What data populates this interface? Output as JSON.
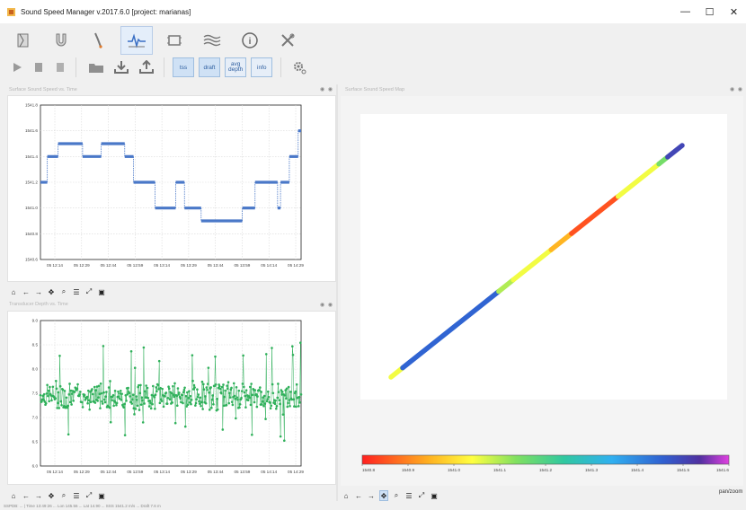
{
  "window": {
    "title": "Sound Speed Manager v.2017.6.0 [project: marianas]",
    "minimize": "—",
    "maximize": "☐",
    "close": "✕"
  },
  "tabs": [
    {
      "icon": "database-icon",
      "active": false
    },
    {
      "icon": "magnet-icon",
      "active": false
    },
    {
      "icon": "probe-icon",
      "active": false
    },
    {
      "icon": "monitor-waveform-icon",
      "active": true
    },
    {
      "icon": "server-icon",
      "active": false
    },
    {
      "icon": "waves-icon",
      "active": false
    },
    {
      "icon": "info-icon",
      "active": false
    },
    {
      "icon": "tools-icon",
      "active": false
    }
  ],
  "toolbar": {
    "tss_label": "tss",
    "draft_label": "draft",
    "avg_top": "avg",
    "avg_bottom": "depth",
    "info_label": "info"
  },
  "panels": {
    "sss_title": "Surface Sound Speed vs. Time",
    "depth_title": "Transducer Depth vs. Time",
    "scatter_title": "Surface Sound Speed Map",
    "panel_ctrls": "◉ ◉"
  },
  "chart_data": [
    {
      "type": "line",
      "title": "",
      "ylim": [
        1540.6,
        1541.8
      ],
      "yticks": [
        "1541.8",
        "1541.6",
        "1541.4",
        "1541.2",
        "1541.0",
        "1540.8",
        "1540.6"
      ],
      "xticks": [
        "05 12:14",
        "05 12:29",
        "05 12:44",
        "05 12:59",
        "05 13:14",
        "05 13:29",
        "05 13:44",
        "05 13:59",
        "05 14:14",
        "05 14:29"
      ],
      "grid": true,
      "color": "#4a78c8",
      "segments": [
        {
          "x0": 0.0,
          "x1": 0.35,
          "y": 1541.2
        },
        {
          "x0": 0.35,
          "x1": 0.9,
          "y": 1541.4
        },
        {
          "x0": 0.9,
          "x1": 2.15,
          "y": 1541.5
        },
        {
          "x0": 2.15,
          "x1": 3.1,
          "y": 1541.4
        },
        {
          "x0": 3.1,
          "x1": 4.3,
          "y": 1541.5
        },
        {
          "x0": 4.3,
          "x1": 4.75,
          "y": 1541.4
        },
        {
          "x0": 4.75,
          "x1": 5.85,
          "y": 1541.2
        },
        {
          "x0": 5.85,
          "x1": 6.9,
          "y": 1541.0
        },
        {
          "x0": 6.9,
          "x1": 7.35,
          "y": 1541.2
        },
        {
          "x0": 7.35,
          "x1": 8.2,
          "y": 1541.0
        },
        {
          "x0": 8.2,
          "x1": 10.3,
          "y": 1540.9
        },
        {
          "x0": 10.3,
          "x1": 10.95,
          "y": 1541.0
        },
        {
          "x0": 10.95,
          "x1": 12.1,
          "y": 1541.2
        },
        {
          "x0": 12.1,
          "x1": 12.25,
          "y": 1541.0
        },
        {
          "x0": 12.25,
          "x1": 12.7,
          "y": 1541.2
        },
        {
          "x0": 12.7,
          "x1": 13.15,
          "y": 1541.4
        },
        {
          "x0": 13.15,
          "x1": 13.3,
          "y": 1541.6
        }
      ],
      "x_domain": [
        0,
        13.3
      ]
    },
    {
      "type": "line",
      "title": "",
      "ylim": [
        6.0,
        9.2
      ],
      "yticks": [
        "9.0",
        "8.5",
        "8.0",
        "7.5",
        "7.0",
        "6.5",
        "6.0"
      ],
      "xticks": [
        "05 12:14",
        "05 12:29",
        "05 12:44",
        "05 12:59",
        "05 13:14",
        "05 13:29",
        "05 13:44",
        "05 13:59",
        "05 14:14",
        "05 14:29"
      ],
      "grid": true,
      "color": "#2fb05a",
      "mean": 7.55,
      "spread": 0.25,
      "points": 420
    },
    {
      "type": "scatter",
      "title": "",
      "colorbar_ticks": [
        "1540.8",
        "1540.9",
        "1541.0",
        "1541.1",
        "1541.2",
        "1541.3",
        "1541.4",
        "1541.5",
        "1541.6"
      ],
      "colorbar_range": [
        1540.8,
        1541.6
      ],
      "segments": [
        {
          "t0": 0.0,
          "t1": 0.04,
          "value": 1541.05
        },
        {
          "t0": 0.04,
          "t1": 0.37,
          "value": 1541.45
        },
        {
          "t0": 0.37,
          "t1": 0.42,
          "value": 1541.1
        },
        {
          "t0": 0.42,
          "t1": 0.55,
          "value": 1541.05
        },
        {
          "t0": 0.55,
          "t1": 0.62,
          "value": 1540.95
        },
        {
          "t0": 0.62,
          "t1": 0.78,
          "value": 1540.85
        },
        {
          "t0": 0.78,
          "t1": 0.92,
          "value": 1541.05
        },
        {
          "t0": 0.92,
          "t1": 0.95,
          "value": 1541.15
        },
        {
          "t0": 0.95,
          "t1": 1.0,
          "value": 1541.5
        }
      ]
    }
  ],
  "nav": {
    "home": "⌂",
    "back": "←",
    "forward": "→",
    "pan": "✥",
    "zoom": "⌕",
    "config": "☰",
    "edit": "⤢",
    "save": "▣"
  },
  "status": {
    "panzoom": "pan/zoom",
    "text": "SSPDB: ... | Time 13:49:26 ... Lon 145.56 ... Lat 14.90 ... SSS 1541.2 m/s ... Draft 7.6 m"
  }
}
